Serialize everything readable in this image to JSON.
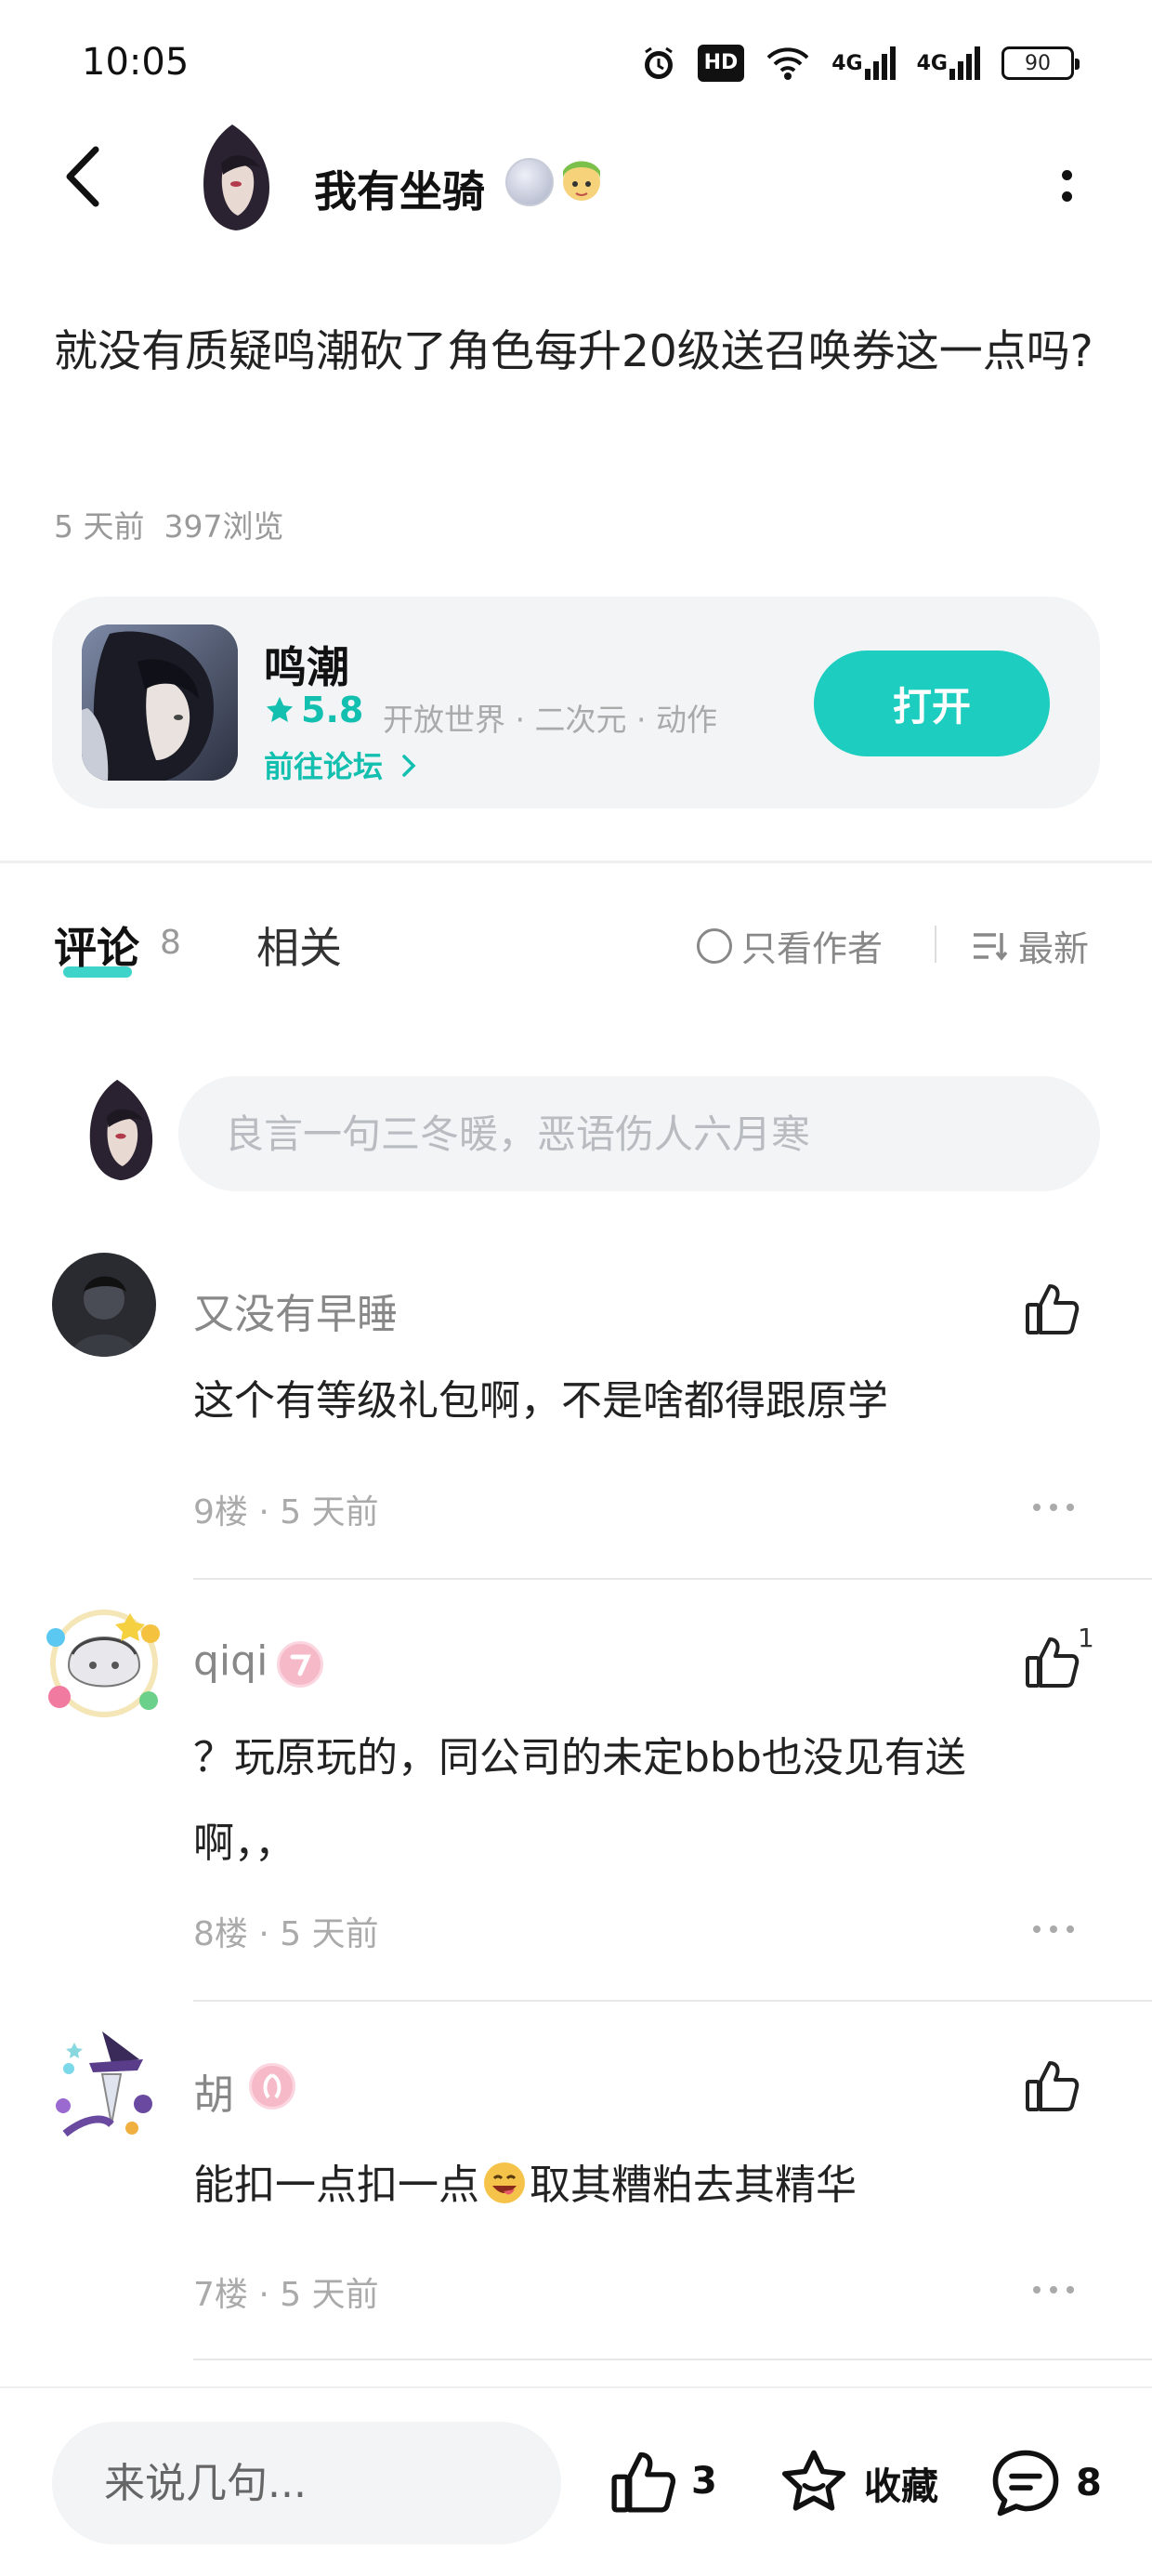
{
  "status_bar": {
    "time": "10:05",
    "hd_label": "HD",
    "net1_label": "4G",
    "net2_label": "4G",
    "battery": "90"
  },
  "header": {
    "author_name": "我有坐骑"
  },
  "post": {
    "title": "就没有质疑鸣潮砍了角色每升20级送召唤券这一点吗?",
    "age": "5 天前",
    "views": "397浏览"
  },
  "game_card": {
    "name": "鸣潮",
    "rating": "5.8",
    "tags": "开放世界 · 二次元 · 动作",
    "forum_link": "前往论坛",
    "open_label": "打开"
  },
  "tabs": {
    "comments_label": "评论",
    "comments_count": "8",
    "related_label": "相关",
    "author_only": "只看作者",
    "sort_label": "最新"
  },
  "comment_input": {
    "placeholder": "良言一句三冬暖，恶语伤人六月寒"
  },
  "comments": [
    {
      "name": "又没有早睡",
      "text": "这个有等级礼包啊，不是啥都得跟原学",
      "floor": "9楼 · 5 天前",
      "likes": ""
    },
    {
      "name": "qiqi",
      "text": "？玩原玩的，同公司的未定bbb也没见有送啊，，",
      "floor": "8楼 · 5 天前",
      "likes": "1"
    },
    {
      "name": "胡",
      "text_before": "能扣一点扣一点",
      "text_after": "取其糟粕去其精华",
      "floor": "7楼 · 5 天前",
      "likes": ""
    }
  ],
  "bottom_bar": {
    "input_placeholder": "来说几句...",
    "like_count": "3",
    "favorite_label": "收藏",
    "comment_count": "8"
  },
  "colors": {
    "accent": "#1dcdbf",
    "accent_text": "#13bfae",
    "card_bg": "#f2f4f6"
  }
}
